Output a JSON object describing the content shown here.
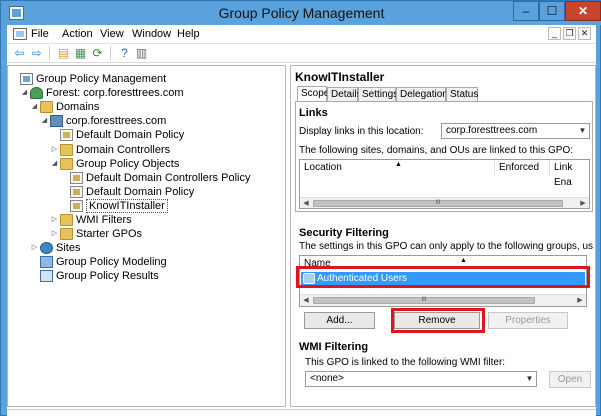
{
  "window": {
    "title": "Group Policy Management",
    "controls": {
      "minimize": "‒",
      "maximize": "☐",
      "close": "✕"
    },
    "mdi_controls": {
      "minimize": "_",
      "restore": "❐",
      "close": "✕"
    }
  },
  "menu": [
    "File",
    "Action",
    "View",
    "Window",
    "Help"
  ],
  "toolbar": {
    "buttons": [
      {
        "name": "back",
        "glyph": "⇦",
        "color": "#2f7ad0"
      },
      {
        "name": "forward",
        "glyph": "⇨",
        "color": "#2f7ad0"
      },
      {
        "name": "up-folder",
        "glyph": "▤",
        "color": "#c9a23a"
      },
      {
        "name": "show-hide-tree",
        "glyph": "▦",
        "color": "#4a8f5a"
      },
      {
        "name": "refresh",
        "glyph": "⟳",
        "color": "#3a8a3a"
      },
      {
        "name": "help",
        "glyph": "?",
        "color": "#2f63b5"
      },
      {
        "name": "properties",
        "glyph": "▥",
        "color": "#6a6a6a"
      }
    ]
  },
  "tree": [
    {
      "label": "Group Policy Management",
      "icon": "gpm",
      "depth": 0,
      "arrow": ""
    },
    {
      "label": "Forest: corp.foresttrees.com",
      "icon": "forest",
      "depth": 1,
      "arrow": "◢"
    },
    {
      "label": "Domains",
      "icon": "folder",
      "depth": 2,
      "arrow": "◢"
    },
    {
      "label": "corp.foresttrees.com",
      "icon": "domain",
      "depth": 3,
      "arrow": "◢"
    },
    {
      "label": "Default Domain Policy",
      "icon": "gpo",
      "depth": 4,
      "arrow": ""
    },
    {
      "label": "Domain Controllers",
      "icon": "folder",
      "depth": 4,
      "arrow": "▷"
    },
    {
      "label": "Group Policy Objects",
      "icon": "folder",
      "depth": 4,
      "arrow": "◢"
    },
    {
      "label": "Default Domain Controllers Policy",
      "icon": "gpo",
      "depth": 5,
      "arrow": ""
    },
    {
      "label": "Default Domain Policy",
      "icon": "gpo",
      "depth": 5,
      "arrow": ""
    },
    {
      "label": "KnowITInstaller",
      "icon": "gpo",
      "depth": 5,
      "arrow": "",
      "selected": true
    },
    {
      "label": "WMI Filters",
      "icon": "folder",
      "depth": 4,
      "arrow": "▷"
    },
    {
      "label": "Starter GPOs",
      "icon": "folder",
      "depth": 4,
      "arrow": "▷"
    },
    {
      "label": "Sites",
      "icon": "sites",
      "depth": 2,
      "arrow": "▷"
    },
    {
      "label": "Group Policy Modeling",
      "icon": "model",
      "depth": 2,
      "arrow": ""
    },
    {
      "label": "Group Policy Results",
      "icon": "results",
      "depth": 2,
      "arrow": ""
    }
  ],
  "details": {
    "title": "KnowITInstaller",
    "tabs": [
      "Scope",
      "Details",
      "Settings",
      "Delegation",
      "Status"
    ],
    "active_tab": "Scope",
    "links": {
      "heading": "Links",
      "display_label": "Display links in this location:",
      "location_value": "corp.foresttrees.com",
      "info": "The following sites, domains, and OUs are linked to this GPO:",
      "columns": [
        "Location",
        "Enforced",
        "Link Ena"
      ],
      "sort_glyph": "▲",
      "scroll_left": "◀",
      "scroll_right": "▶",
      "thumb_glyph": "III"
    },
    "security": {
      "heading": "Security Filtering",
      "info": "The settings in this GPO can only apply to the following groups, users, and cor",
      "columns": [
        "Name"
      ],
      "sort_glyph": "▲",
      "rows": [
        "Authenticated Users"
      ],
      "scroll_left": "◀",
      "scroll_right": "▶",
      "thumb_glyph": "III",
      "add_label": "Add...",
      "remove_label": "Remove",
      "properties_label": "Properties"
    },
    "wmi": {
      "heading": "WMI Filtering",
      "info": "This GPO is linked to the following WMI filter:",
      "filter_value": "<none>",
      "open_label": "Open"
    }
  },
  "colors": {
    "titlebar": "#5aa2dc",
    "selection": "#3399ff",
    "highlight": "#e0141b",
    "close_button": "#c7442e"
  }
}
